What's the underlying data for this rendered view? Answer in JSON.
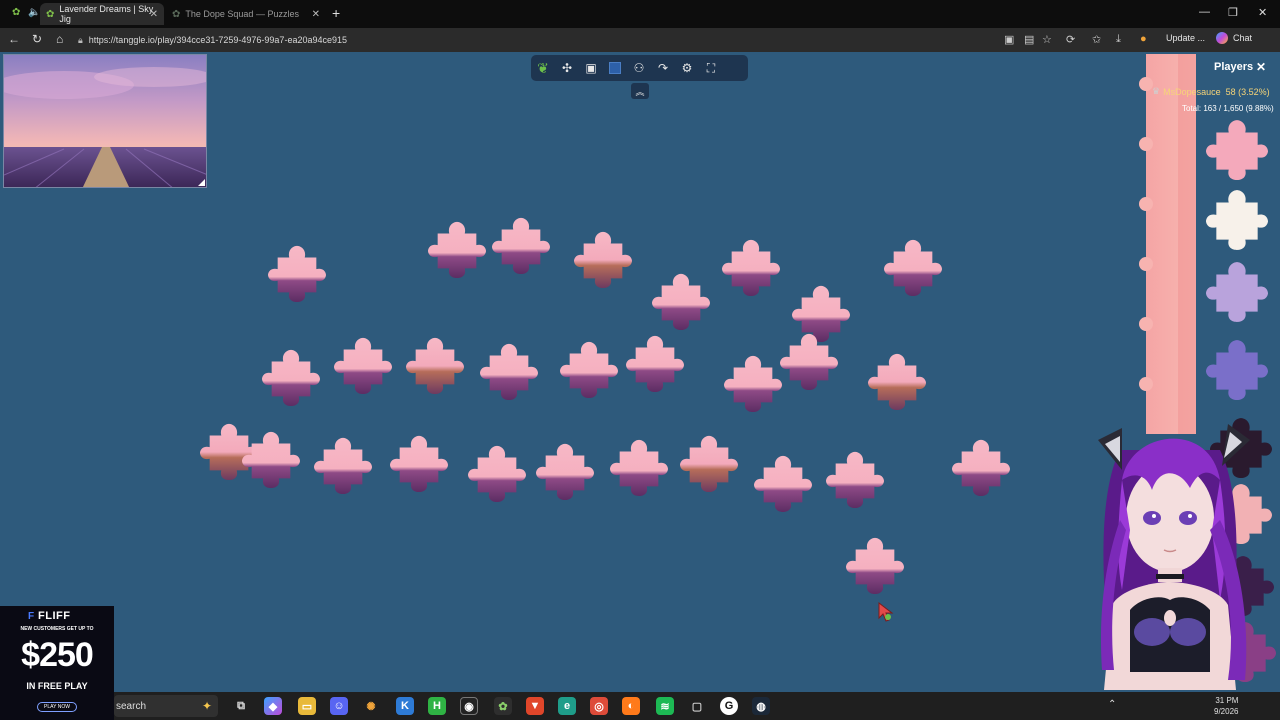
{
  "browser": {
    "tabs": [
      {
        "label": "Lavender Dreams | Sky Jig",
        "active": true
      },
      {
        "label": "The Dope Squad — Puzzles",
        "active": false
      }
    ],
    "url": "https://tanggle.io/play/394cce31-7259-4976-99a7-ea20a94ce915",
    "update_label": "Update",
    "more_label": "...",
    "chat_label": "Chat"
  },
  "players": {
    "title": "Players",
    "entries": [
      {
        "name": "MsDopesauce",
        "score": "58 (3.52%)"
      }
    ],
    "total": "Total: 163 / 1,650 (9.88%)"
  },
  "toolbar": {
    "icons": [
      "leaf-icon",
      "puzzle-piece-icon",
      "image-icon",
      "background-color-icon",
      "players-icon",
      "share-icon",
      "settings-icon",
      "fullscreen-icon"
    ]
  },
  "ad": {
    "brand": "FLIFF",
    "tagline_1": "NEW CUSTOMERS GET UP TO",
    "amount": "$250",
    "subline": "IN FREE PLAY",
    "cta": "PLAY NOW"
  },
  "taskbar": {
    "search_placeholder": "search",
    "clock_time": "31 PM",
    "clock_date": "9/2026"
  },
  "colors": {
    "board": "#2e5a7c",
    "piece_sky": "#f7b3c2",
    "piece_lavender": "#7a3e7a",
    "accent_pink": "#f39c9c",
    "player_name": "#f6d478"
  }
}
